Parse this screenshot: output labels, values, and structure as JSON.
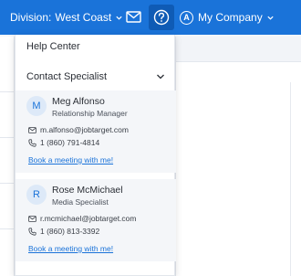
{
  "topbar": {
    "division_label": "Division:",
    "division_value": "West Coast",
    "company_initial": "A",
    "company_name": "My Company"
  },
  "menu": {
    "help_center": "Help Center",
    "contact_specialist": "Contact Specialist"
  },
  "specialists": [
    {
      "initial": "M",
      "name": "Meg Alfonso",
      "role": "Relationship Manager",
      "email": "m.alfonso@jobtarget.com",
      "phone": "1 (860) 791-4814",
      "book_label": "Book a meeting with me!"
    },
    {
      "initial": "R",
      "name": "Rose McMichael",
      "role": "Media Specialist",
      "email": "r.mcmichael@jobtarget.com",
      "phone": "1 (860) 813-3392",
      "book_label": "Book a meeting with me!"
    }
  ],
  "colors": {
    "brand_blue": "#1a73d9",
    "active_blue": "#0f5bb5",
    "card_bg": "#f4f6f9"
  },
  "icons": {
    "mail": "mail-icon",
    "help": "question-circle-icon",
    "chevron": "chevron-down-icon",
    "phone": "phone-icon"
  }
}
